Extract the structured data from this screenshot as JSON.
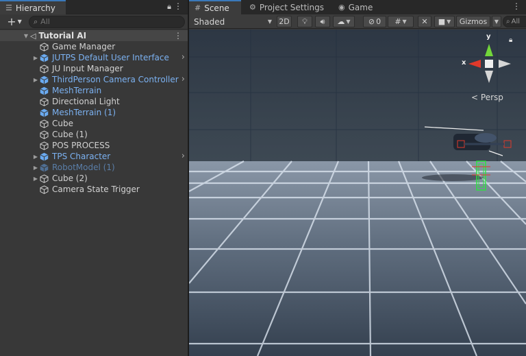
{
  "hierarchy": {
    "tab_label": "Hierarchy",
    "search_placeholder": "All",
    "scene_name": "Tutorial AI",
    "items": [
      {
        "label": "Game Manager",
        "kind": "normal",
        "foldout": false,
        "arrow": false
      },
      {
        "label": "JUTPS Default User Interface",
        "kind": "prefab",
        "foldout": true,
        "arrow": true
      },
      {
        "label": "JU Input Manager",
        "kind": "normal",
        "foldout": false,
        "arrow": false
      },
      {
        "label": "ThirdPerson Camera Controller",
        "kind": "prefab",
        "foldout": true,
        "arrow": true
      },
      {
        "label": "MeshTerrain",
        "kind": "prefab",
        "foldout": false,
        "arrow": false
      },
      {
        "label": "Directional Light",
        "kind": "normal",
        "foldout": false,
        "arrow": false
      },
      {
        "label": "MeshTerrain (1)",
        "kind": "prefab",
        "foldout": false,
        "arrow": false
      },
      {
        "label": "Cube",
        "kind": "normal",
        "foldout": false,
        "arrow": false
      },
      {
        "label": "Cube (1)",
        "kind": "normal",
        "foldout": false,
        "arrow": false
      },
      {
        "label": "POS PROCESS",
        "kind": "normal",
        "foldout": false,
        "arrow": false
      },
      {
        "label": "TPS Character",
        "kind": "prefab",
        "foldout": true,
        "arrow": true
      },
      {
        "label": "RobotModel (1)",
        "kind": "dim",
        "foldout": true,
        "arrow": false
      },
      {
        "label": "Cube (2)",
        "kind": "normal",
        "foldout": true,
        "arrow": false
      },
      {
        "label": "Camera State Trigger",
        "kind": "normal",
        "foldout": false,
        "arrow": false
      }
    ]
  },
  "scene_view": {
    "tabs": [
      {
        "label": "Scene",
        "icon": "grid-icon"
      },
      {
        "label": "Project Settings",
        "icon": "gear-icon"
      },
      {
        "label": "Game",
        "icon": "gamepad-icon"
      }
    ],
    "draw_mode": "Shaded",
    "toggle_2d": "2D",
    "hidden_count": "0",
    "gizmos_label": "Gizmos",
    "search_placeholder": "All",
    "projection_label": "Persp",
    "axis_labels": {
      "x": "x",
      "y": "y"
    },
    "colors": {
      "x_axis": "#e0392b",
      "y_axis": "#72d63a",
      "accent": "#3a79bb",
      "prefab_text": "#7cb2f2",
      "selection": "#27e83a"
    }
  }
}
